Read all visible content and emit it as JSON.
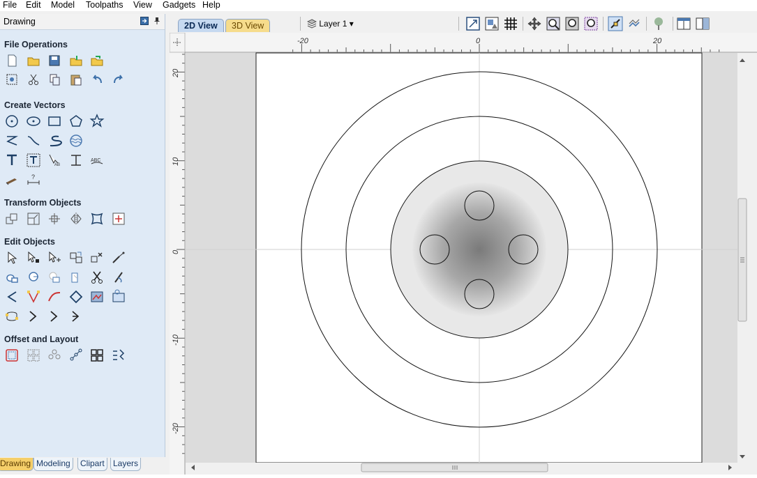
{
  "menu": [
    "File",
    "Edit",
    "Model",
    "Toolpaths",
    "View",
    "Gadgets",
    "Help"
  ],
  "panel": {
    "title": "Drawing",
    "sections": [
      {
        "title": "File Operations",
        "tools": [
          [
            "new-file-icon",
            "open-file-icon",
            "save-file-icon",
            "import-vectors-icon",
            "import-component-icon"
          ],
          [
            "group-select-icon",
            "cut-icon",
            "copy-icon",
            "paste-icon",
            "undo-icon",
            "redo-icon"
          ]
        ]
      },
      {
        "title": "Create Vectors",
        "tools": [
          [
            "circle-icon",
            "ellipse-icon",
            "rectangle-icon",
            "polygon-icon",
            "star-icon"
          ],
          [
            "polyline-icon",
            "curve-icon",
            "s-curve-icon",
            "wave-icon"
          ],
          [
            "text-icon",
            "text-box-icon",
            "text-on-curve-icon",
            "text-auto-layout-icon",
            "text-arc-icon"
          ],
          [
            "dimension-icon",
            "measure-icon"
          ]
        ]
      },
      {
        "title": "Transform Objects",
        "tools": [
          [
            "move-icon",
            "scale-icon",
            "rotate-icon",
            "mirror-icon",
            "distort-icon",
            "align-icon"
          ]
        ]
      },
      {
        "title": "Edit Objects",
        "tools": [
          [
            "select-icon",
            "node-edit-icon",
            "transform-select-icon",
            "group-icon",
            "ungroup-icon",
            "weld-icon"
          ],
          [
            "join-icon",
            "join-close-icon",
            "trim-icon",
            "fillet-icon",
            "scissors-icon",
            "knife-icon"
          ],
          [
            "smooth-icon",
            "node-point-icon",
            "curve-fit-icon",
            "close-vector-icon",
            "bitmap-trace-icon",
            "image-icon"
          ],
          [
            "offset-node-icon",
            "node-arrow-icon",
            "node-arrow2-icon",
            "node-arrow3-icon"
          ]
        ]
      },
      {
        "title": "Offset and Layout",
        "tools": [
          [
            "offset-icon",
            "array-icon",
            "circular-array-icon",
            "nest-icon",
            "layout-grid-icon",
            "auto-space-icon"
          ]
        ]
      }
    ]
  },
  "bottom_tabs": [
    {
      "label": "Drawing",
      "active": true
    },
    {
      "label": "Modeling",
      "active": false
    },
    {
      "label": "Clipart",
      "active": false
    },
    {
      "label": "Layers",
      "active": false
    }
  ],
  "view_tabs": {
    "active": "2D View",
    "inactive": "3D View"
  },
  "layer": {
    "label": "Layer 1"
  },
  "ruler": {
    "h_labels": [
      "-20",
      "0",
      "20"
    ],
    "v_labels": [
      "20",
      "10",
      "0",
      "-10",
      "-20"
    ]
  },
  "canvas": {
    "ring_count": 3,
    "inner_circle_count": 4
  },
  "colors": {
    "panel_bg": "#dfeaf6",
    "active_tab": "#f5cf6a",
    "view_tab_2d": "#c6d9f0",
    "view_tab_3d": "#f6dc8c",
    "canvas_white": "#ffffff",
    "canvas_grey": "#dcdcdc"
  }
}
